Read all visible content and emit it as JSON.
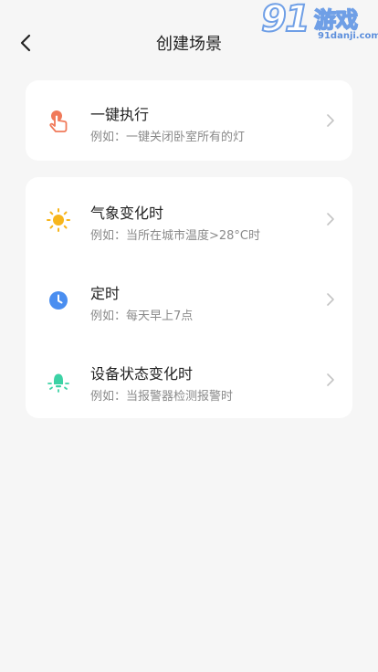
{
  "header": {
    "title": "创建场景",
    "back_icon": "chevron-left-icon"
  },
  "watermark": {
    "number": "91",
    "name": "游戏",
    "url": "91danji.com"
  },
  "colors": {
    "background": "#f6f6f6",
    "card": "#ffffff",
    "hand_icon": "#f07a5a",
    "sun_icon": "#f7b51c",
    "clock_icon": "#4a8ef0",
    "bulb_icon": "#3cd2a5",
    "secondary_text": "#8a8a8a"
  },
  "manual_card": {
    "items": [
      {
        "icon": "hand-tap-icon",
        "title": "一键执行",
        "subtitle": "例如：一键关闭卧室所有的灯"
      }
    ]
  },
  "auto_card": {
    "items": [
      {
        "icon": "sun-icon",
        "title": "气象变化时",
        "subtitle": "例如：当所在城市温度>28°C时"
      },
      {
        "icon": "clock-icon",
        "title": "定时",
        "subtitle": "例如：每天早上7点"
      },
      {
        "icon": "bulb-icon",
        "title": "设备状态变化时",
        "subtitle": "例如：当报警器检测报警时"
      }
    ]
  }
}
